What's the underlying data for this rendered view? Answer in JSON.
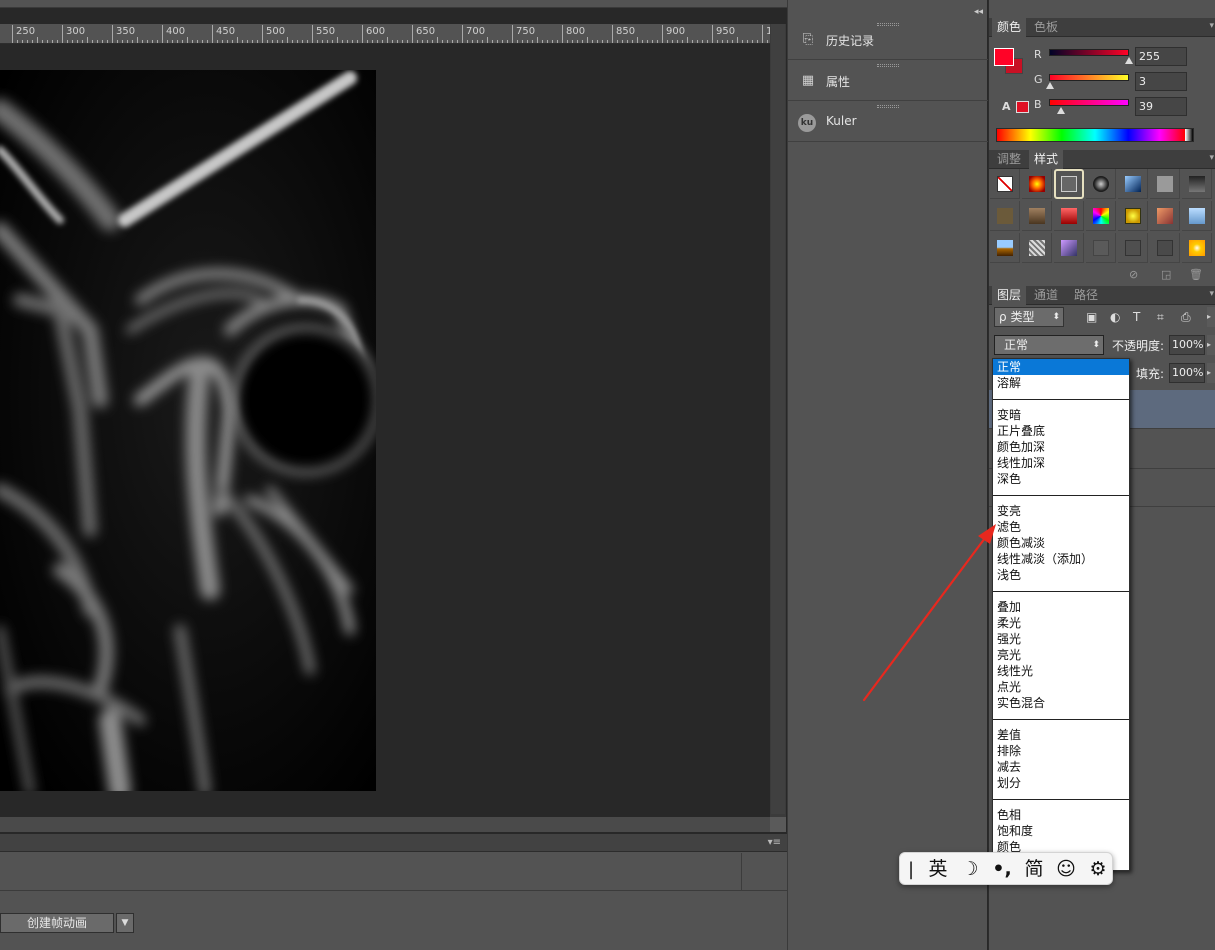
{
  "ruler": {
    "ticks": [
      "250",
      "300",
      "350",
      "400",
      "450",
      "500",
      "550",
      "600",
      "650",
      "700",
      "750",
      "800",
      "850",
      "900",
      "950",
      "1"
    ]
  },
  "timeline": {
    "create_frame_animation": "创建帧动画",
    "dropdown_icon": "chevron-down-icon"
  },
  "collapsed_panels": [
    {
      "label": "历史记录",
      "icon": "history-icon"
    },
    {
      "label": "属性",
      "icon": "properties-icon"
    },
    {
      "label": "Kuler",
      "icon": "kuler-icon",
      "badge": "ku"
    }
  ],
  "color_panel": {
    "tabs": [
      "颜色",
      "色板"
    ],
    "active_tab": "颜色",
    "channels": [
      {
        "label": "R",
        "value": "255"
      },
      {
        "label": "G",
        "value": "3"
      },
      {
        "label": "B",
        "value": "39"
      }
    ],
    "foreground_color": "#ff0327",
    "warning_icon": "A"
  },
  "styles_panel": {
    "tabs": [
      "调整",
      "样式"
    ],
    "active_tab": "样式"
  },
  "layers_panel": {
    "tabs": [
      "图层",
      "通道",
      "路径"
    ],
    "active_tab": "图层",
    "filter_kind": "类型",
    "filter_search_glyph": "ρ",
    "blend_mode": "正常",
    "opacity_label": "不透明度:",
    "opacity_value": "100%",
    "fill_label": "填充:",
    "fill_value": "100%"
  },
  "blend_menu": {
    "groups": [
      [
        "正常",
        "溶解"
      ],
      [
        "变暗",
        "正片叠底",
        "颜色加深",
        "线性加深",
        "深色"
      ],
      [
        "变亮",
        "滤色",
        "颜色减淡",
        "线性减淡（添加）",
        "浅色"
      ],
      [
        "叠加",
        "柔光",
        "强光",
        "亮光",
        "线性光",
        "点光",
        "实色混合"
      ],
      [
        "差值",
        "排除",
        "减去",
        "划分"
      ],
      [
        "色相",
        "饱和度",
        "颜色"
      ]
    ],
    "selected": "正常"
  },
  "ime_toolbar": {
    "items": [
      "英",
      "☽",
      "•,",
      "简",
      "☺",
      "⚙"
    ],
    "icons": [
      "language-english-icon",
      "moon-icon",
      "punctuation-icon",
      "simplified-chinese-icon",
      "emoji-icon",
      "settings-icon"
    ]
  },
  "annotation": {
    "arrow_color": "#e8281e"
  }
}
